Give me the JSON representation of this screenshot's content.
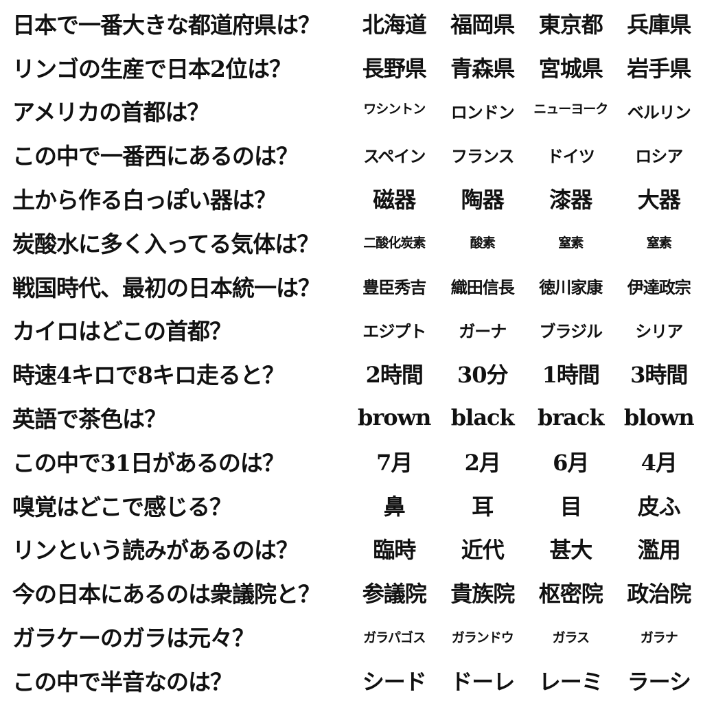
{
  "rows": [
    {
      "question": "日本で一番大きな都道府県は？",
      "choices": [
        "北海道",
        "福岡県",
        "東京都",
        "兵庫県"
      ],
      "size": [
        "big",
        "big",
        "big",
        "big"
      ]
    },
    {
      "question": "リンゴの生産で日本2位は？",
      "choices": [
        "長野県",
        "青森県",
        "宮城県",
        "岩手県"
      ],
      "size": [
        "big",
        "big",
        "big",
        "big"
      ]
    },
    {
      "question": "アメリカの首都は？",
      "choices": [
        "ワシントン",
        "ロンドン",
        "ニューヨーク",
        "ベルリン"
      ],
      "size": [
        "small",
        "mid",
        "small",
        "mid"
      ]
    },
    {
      "question": "この中で一番西にあるのは？",
      "choices": [
        "スペイン",
        "フランス",
        "ドイツ",
        "ロシア"
      ],
      "size": [
        "mid",
        "mid",
        "mid",
        "mid"
      ]
    },
    {
      "question": "土から作る白っぽい器は？",
      "choices": [
        "磁器",
        "陶器",
        "漆器",
        "大器"
      ],
      "size": [
        "big",
        "big",
        "big",
        "big"
      ]
    },
    {
      "question": "炭酸水に多く入ってる気体は？",
      "choices": [
        "二酸化炭素",
        "酸素",
        "窒素",
        "窒素"
      ],
      "size": [
        "small",
        "small",
        "small",
        "small"
      ]
    },
    {
      "question": "戦国時代、最初の日本統一は？",
      "choices": [
        "豊臣秀吉",
        "織田信長",
        "徳川家康",
        "伊達政宗"
      ],
      "size": [
        "mid",
        "mid",
        "mid",
        "mid"
      ]
    },
    {
      "question": "カイロはどこの首都？",
      "choices": [
        "エジプト",
        "ガーナ",
        "ブラジル",
        "シリア"
      ],
      "size": [
        "mid",
        "mid",
        "mid",
        "mid"
      ]
    },
    {
      "question": "時速4キロで8キロ走ると？",
      "choices": [
        "2時間",
        "30分",
        "1時間",
        "3時間"
      ],
      "size": [
        "big",
        "big",
        "big",
        "big"
      ]
    },
    {
      "question": "英語で茶色は？",
      "choices": [
        "brown",
        "black",
        "brack",
        "blown"
      ],
      "size": [
        "latin",
        "latin",
        "latin",
        "latin"
      ]
    },
    {
      "question": "この中で31日があるのは？",
      "choices": [
        "7月",
        "2月",
        "6月",
        "4月"
      ],
      "size": [
        "big",
        "big",
        "big",
        "big"
      ]
    },
    {
      "question": "嗅覚はどこで感じる？",
      "choices": [
        "鼻",
        "耳",
        "目",
        "皮ふ"
      ],
      "size": [
        "big",
        "big",
        "big",
        "big"
      ]
    },
    {
      "question": "リンという読みがあるのは？",
      "choices": [
        "臨時",
        "近代",
        "甚大",
        "濫用"
      ],
      "size": [
        "big",
        "big",
        "big",
        "big"
      ]
    },
    {
      "question": "今の日本にあるのは衆議院と？",
      "choices": [
        "参議院",
        "貴族院",
        "枢密院",
        "政治院"
      ],
      "size": [
        "big",
        "big",
        "big",
        "big"
      ]
    },
    {
      "question": "ガラケーのガラは元々？",
      "choices": [
        "ガラパゴス",
        "ガランドウ",
        "ガラス",
        "ガラナ"
      ],
      "size": [
        "small",
        "small",
        "small",
        "small"
      ]
    },
    {
      "question": "この中で半音なのは？",
      "choices": [
        "シード",
        "ドーレ",
        "レーミ",
        "ラーシ"
      ],
      "size": [
        "big",
        "big",
        "big",
        "big"
      ]
    }
  ]
}
